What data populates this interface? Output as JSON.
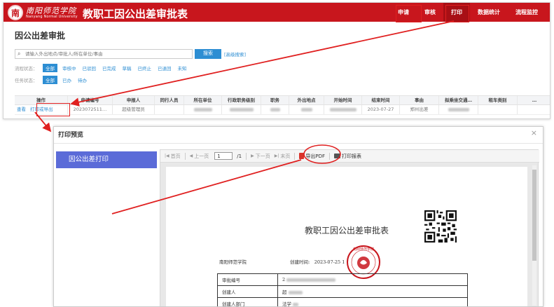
{
  "header": {
    "logo_glyph": "南",
    "school_name": "南阳师范学院",
    "school_name_en": "Nanyang Normal University",
    "app_title": "教职工因公出差审批表",
    "nav": [
      "申请",
      "审核",
      "打印",
      "数据统计",
      "流程监控"
    ],
    "active_nav": "打印"
  },
  "page": {
    "title": "因公出差审批",
    "search_placeholder": "请输入外出地点/审批人/所在单位/事由",
    "search_button": "搜索",
    "advanced_search": "[高级搜索]",
    "flow_label": "流程状态：",
    "flow_options": [
      "全部",
      "审核中",
      "已驳回",
      "已完成",
      "草稿",
      "已终止",
      "已退回",
      "未知"
    ],
    "task_label": "任务状态：",
    "task_options": [
      "全部",
      "已办",
      "待办"
    ]
  },
  "table": {
    "headers": [
      "操作",
      "申请编号",
      "申报人",
      "同行人员",
      "所在单位",
      "行政职务级别",
      "职务",
      "外出地点",
      "开始时间",
      "结束时间",
      "事由",
      "拟乘坐交通…",
      "租车类别",
      "…"
    ],
    "row": {
      "view": "查看",
      "print_export": "打印或导出",
      "apply_no": "2023072511…",
      "applicant": "超级管理员",
      "end_time": "2023-07-27",
      "reason": "郑州出差"
    }
  },
  "dialog": {
    "title": "打印预览",
    "close": "×",
    "side_item": "因公出差打印",
    "toolbar": {
      "first": "首页",
      "prev": "上一页",
      "page": "1",
      "total": "/1",
      "next": "下一页",
      "last": "末页",
      "export_pdf": "导出PDF",
      "print_report": "打印报表"
    },
    "document": {
      "title": "教职工因公出差审批表",
      "org": "南阳师范学院",
      "created_time": "创建时间:　2023-07-25 1",
      "seal_text": "南阳师范学院",
      "rows": [
        {
          "key": "审批编号",
          "value": "2"
        },
        {
          "key": "创建人",
          "value": "超"
        },
        {
          "key": "创建人部门",
          "value": "法学"
        },
        {
          "key": "申报人",
          "value": ""
        }
      ]
    }
  },
  "colors": {
    "header_red": "#c8161d",
    "highlight_red": "#e02020",
    "link_blue": "#2d8ed3",
    "side_blue": "#5b6bd8"
  }
}
